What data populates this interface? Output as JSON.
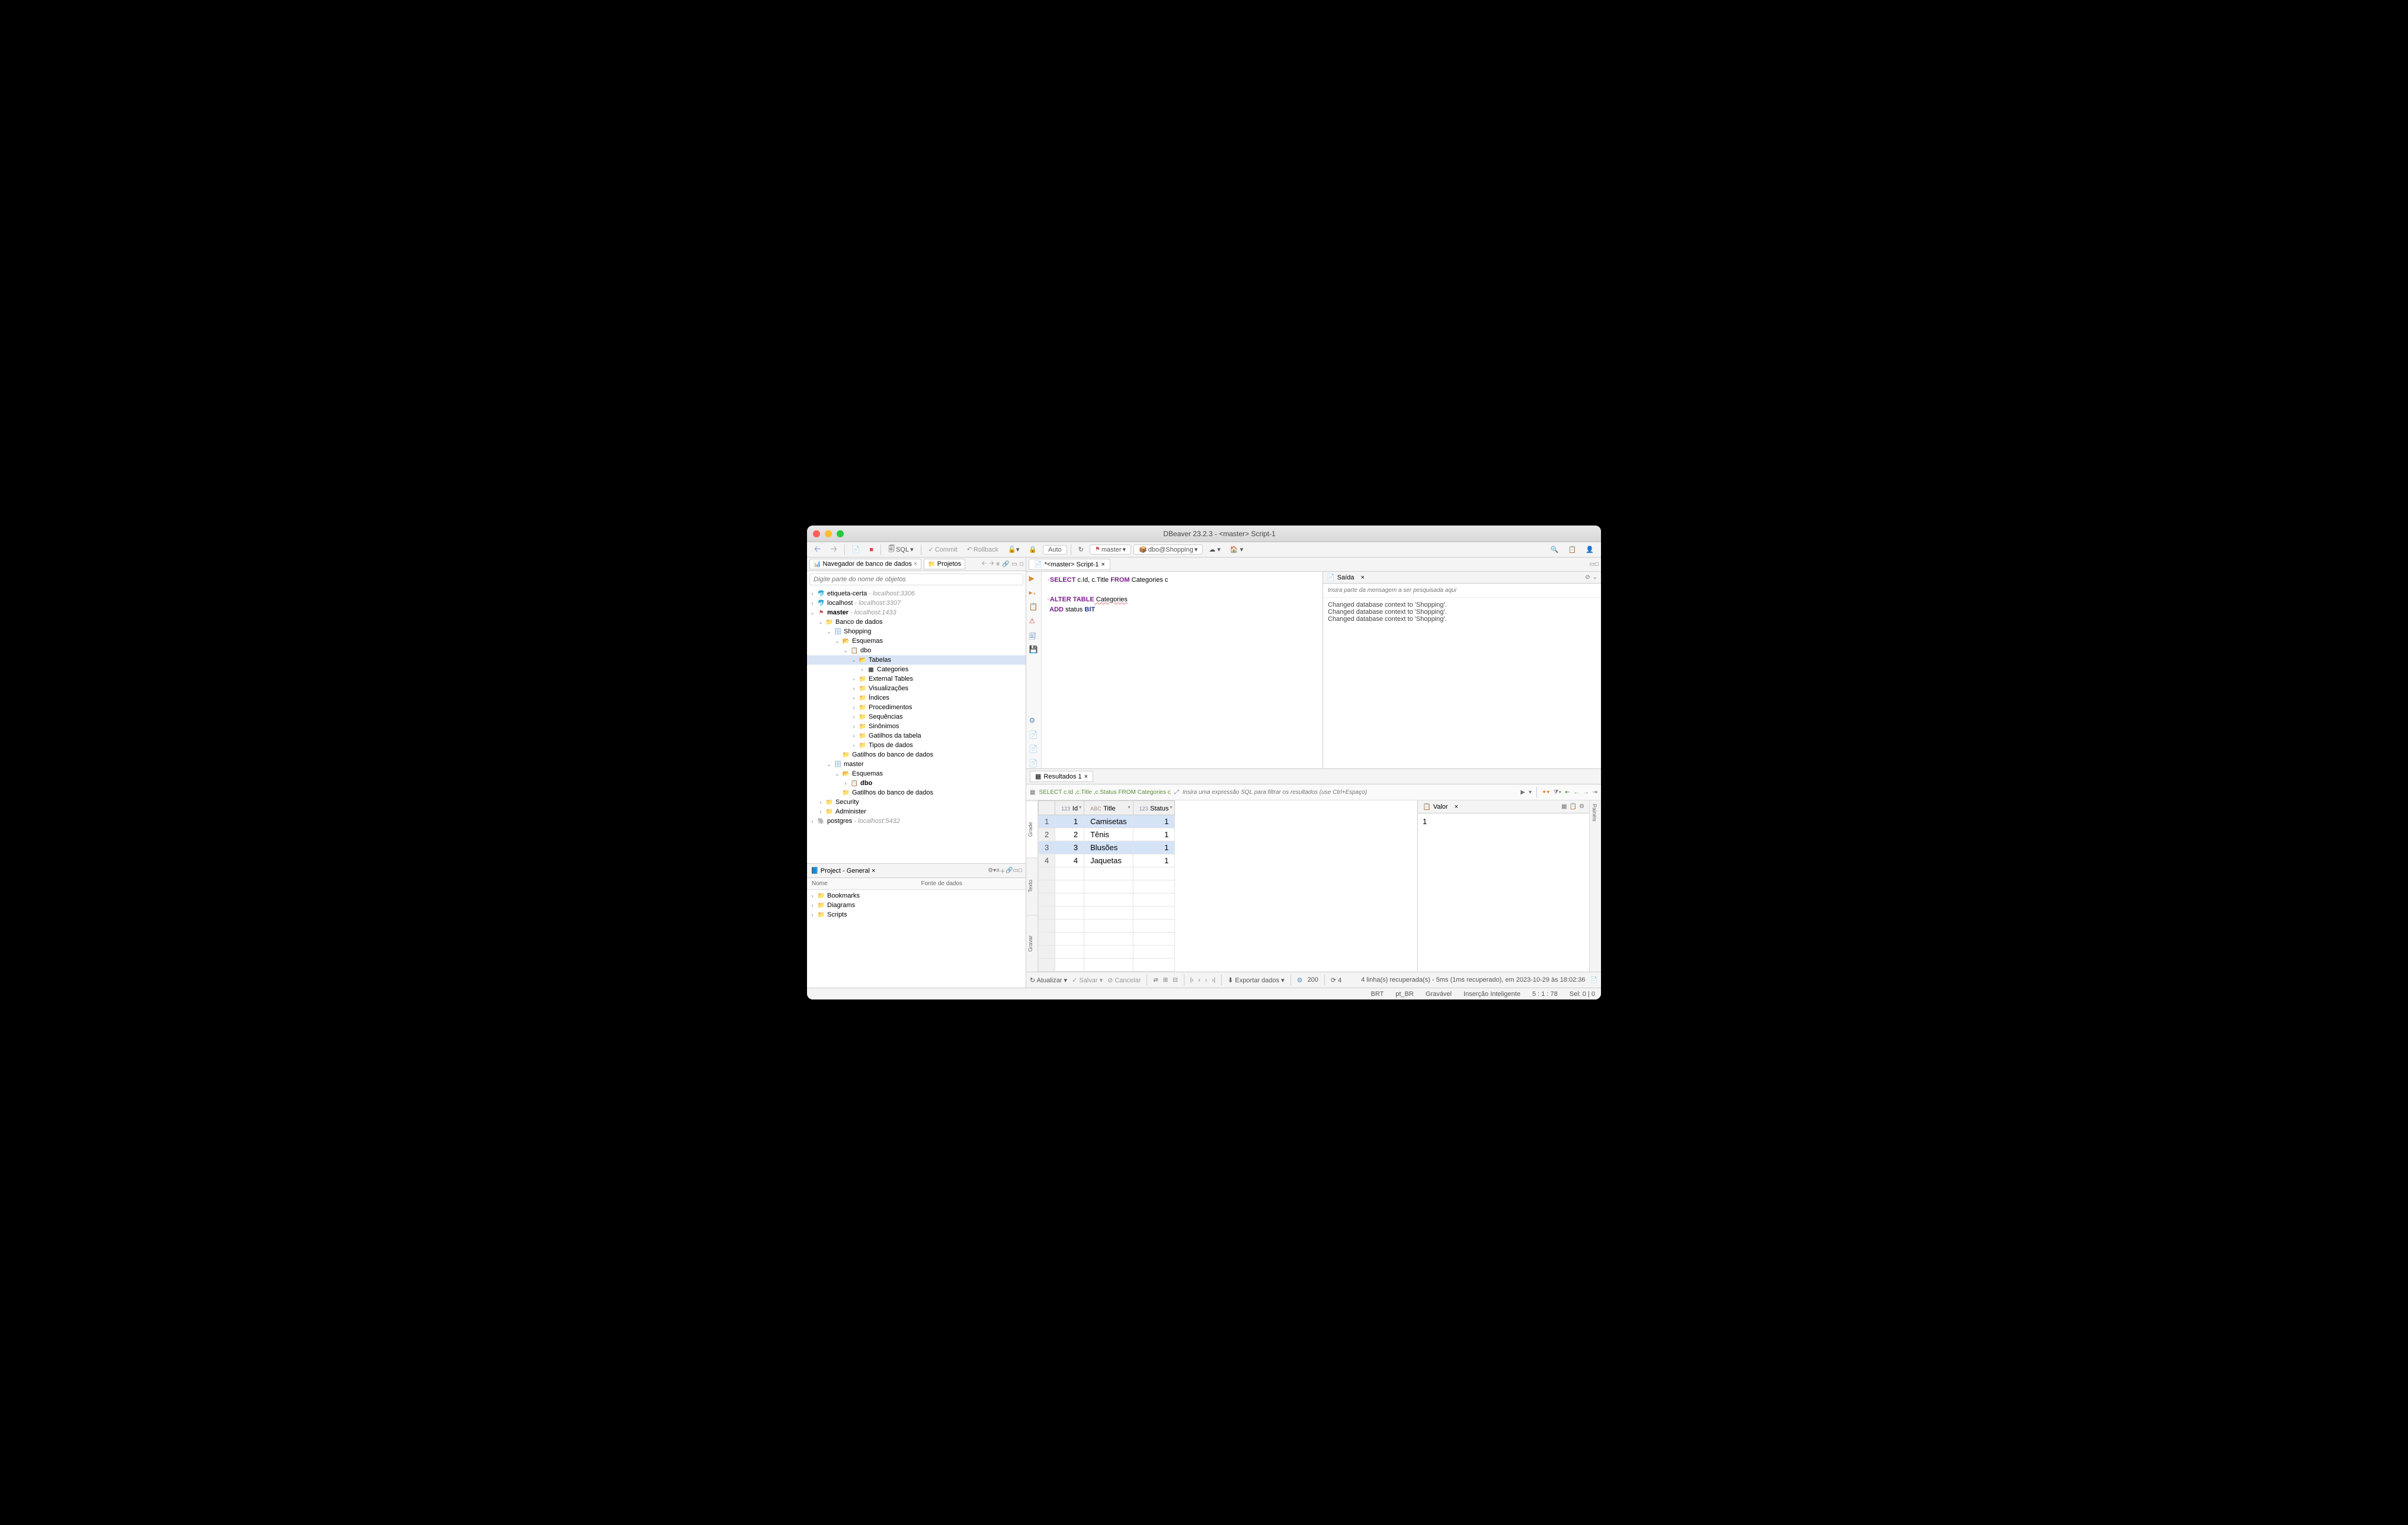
{
  "title": "DBeaver 23.2.3 - <master> Script-1",
  "toolbar": {
    "sql_label": "SQL",
    "commit": "Commit",
    "rollback": "Rollback",
    "auto": "Auto",
    "conn": "master",
    "db": "dbo@Shopping"
  },
  "nav": {
    "tab1": "Navegador de banco de dados",
    "tab2": "Projetos",
    "filter_ph": "Digite parte do nome de objetos",
    "tree": {
      "etiqueta": "etiqueta-certa",
      "etiqueta_h": " - localhost:3306",
      "localhost": "localhost",
      "localhost_h": " - localhost:3307",
      "master": "master",
      "master_h": " - localhost:1433",
      "banco": "Banco de dados",
      "shopping": "Shopping",
      "esquemas": "Esquemas",
      "dbo": "dbo",
      "tabelas": "Tabelas",
      "categories": "Categories",
      "ext": "External Tables",
      "viz": "Visualizações",
      "idx": "Índices",
      "proc": "Procedimentos",
      "seq": "Sequências",
      "syn": "Sinônimos",
      "gat": "Gatilhos da tabela",
      "tipos": "Tipos de dados",
      "gatbd": "Gatilhos do banco de dados",
      "master2": "master",
      "esq2": "Esquemas",
      "dbo2": "dbo",
      "gat2": "Gatilhos do banco de dados",
      "sec": "Security",
      "admin": "Administer",
      "pg": "postgres",
      "pg_h": " - localhost:5432"
    }
  },
  "project": {
    "title": "Project - General",
    "col1": "Nome",
    "col2": "Fonte de dados",
    "bookmarks": "Bookmarks",
    "diagrams": "Diagrams",
    "scripts": "Scripts"
  },
  "editor": {
    "tab": "*<master> Script-1",
    "line1a": "SELECT",
    "line1b": " c.Id, c.Title ",
    "line1c": "FROM",
    "line1d": " Categories c",
    "line2a": "ALTER TABLE",
    "line2b": " Categories",
    "line3a": "ADD",
    "line3b": " status ",
    "line3c": "BIT"
  },
  "output": {
    "tab": "Saída",
    "filter_ph": "Insira parte da mensagem a ser pesquisada aqui",
    "msg1": "Changed database context to 'Shopping'.",
    "msg2": "Changed database context to 'Shopping'.",
    "msg3": "Changed database context to 'Shopping'."
  },
  "results": {
    "tab": "Resultados 1",
    "query": "SELECT c.Id ,c.Title ,c.Status FROM Categories c",
    "filter_ph": "Insira uma expressão SQL para filtrar os resultados (use Ctrl+Espaço)",
    "vtab_grade": "Grade",
    "vtab_texto": "Texto",
    "vtab_gravar": "Gravar",
    "cols": {
      "id": "Id",
      "title": "Title",
      "status": "Status"
    },
    "rows": [
      {
        "n": "1",
        "id": "1",
        "title": "Camisetas",
        "status": "1"
      },
      {
        "n": "2",
        "id": "2",
        "title": "Tênis",
        "status": "1"
      },
      {
        "n": "3",
        "id": "3",
        "title": "Blusões",
        "status": "1"
      },
      {
        "n": "4",
        "id": "4",
        "title": "Jaquetas",
        "status": "1"
      }
    ],
    "valor": "Valor",
    "valor_val": "1",
    "paineis": "Painéis",
    "atualizar": "Atualizar",
    "salvar": "Salvar",
    "cancelar": "Cancelar",
    "exportar": "Exportar dados",
    "count_in": "200",
    "rows_n": "4",
    "summary": "4 linha(s) recuperada(s) - 5ms (1ms recuperado), em 2023-10-29 às 18:02:36"
  },
  "status": {
    "tz": "BRT",
    "locale": "pt_BR",
    "write": "Gravável",
    "ins": "Inserção Inteligente",
    "pos": "5 : 1 : 78",
    "sel": "Sel: 0 | 0"
  }
}
